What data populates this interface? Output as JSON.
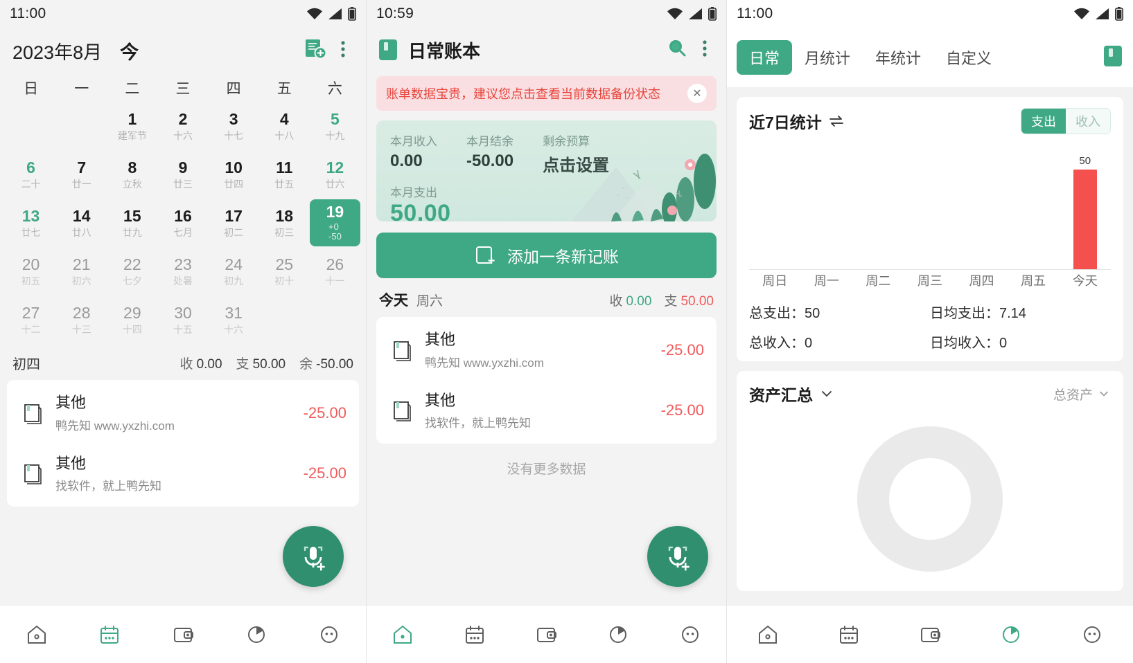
{
  "theme": {
    "green": "#3fa885",
    "green_dark": "#2f8f6e",
    "red": "#f05a5a",
    "bar_red": "#f4514e",
    "alert_bg": "#f9dfe2",
    "alert_text": "#e8453c"
  },
  "panel1": {
    "status": {
      "time": "11:00"
    },
    "header": {
      "month_title": "2023年8月",
      "today_label": "今",
      "add_note_icon": "note-add-icon",
      "more_icon": "more-vertical-icon"
    },
    "weekdays": [
      "日",
      "一",
      "二",
      "三",
      "四",
      "五",
      "六"
    ],
    "days": [
      {
        "num": "",
        "lunar": "",
        "empty": true
      },
      {
        "num": "",
        "lunar": "",
        "empty": true
      },
      {
        "num": "1",
        "lunar": "建军节"
      },
      {
        "num": "2",
        "lunar": "十六"
      },
      {
        "num": "3",
        "lunar": "十七"
      },
      {
        "num": "4",
        "lunar": "十八"
      },
      {
        "num": "5",
        "lunar": "十九",
        "weekend": true
      },
      {
        "num": "6",
        "lunar": "二十",
        "weekend": true
      },
      {
        "num": "7",
        "lunar": "廿一"
      },
      {
        "num": "8",
        "lunar": "立秋"
      },
      {
        "num": "9",
        "lunar": "廿三"
      },
      {
        "num": "10",
        "lunar": "廿四"
      },
      {
        "num": "11",
        "lunar": "廿五"
      },
      {
        "num": "12",
        "lunar": "廿六",
        "weekend": true
      },
      {
        "num": "13",
        "lunar": "廿七",
        "weekend": true
      },
      {
        "num": "14",
        "lunar": "廿八"
      },
      {
        "num": "15",
        "lunar": "廿九"
      },
      {
        "num": "16",
        "lunar": "七月"
      },
      {
        "num": "17",
        "lunar": "初二"
      },
      {
        "num": "18",
        "lunar": "初三"
      },
      {
        "num": "19",
        "lunar": "+0\n-50",
        "selected": true
      },
      {
        "num": "20",
        "lunar": "初五",
        "grey": true
      },
      {
        "num": "21",
        "lunar": "初六",
        "grey": true
      },
      {
        "num": "22",
        "lunar": "七夕",
        "grey": true
      },
      {
        "num": "23",
        "lunar": "处暑",
        "grey": true
      },
      {
        "num": "24",
        "lunar": "初九",
        "grey": true
      },
      {
        "num": "25",
        "lunar": "初十",
        "grey": true
      },
      {
        "num": "26",
        "lunar": "十一",
        "grey": true
      },
      {
        "num": "27",
        "lunar": "十二",
        "grey": true
      },
      {
        "num": "28",
        "lunar": "十三",
        "grey": true
      },
      {
        "num": "29",
        "lunar": "十四",
        "grey": true
      },
      {
        "num": "30",
        "lunar": "十五",
        "grey": true
      },
      {
        "num": "31",
        "lunar": "十六",
        "grey": true
      }
    ],
    "day_summary": {
      "lunar": "初四",
      "income_label": "收",
      "income_value": "0.00",
      "expense_label": "支",
      "expense_value": "50.00",
      "balance_label": "余",
      "balance_value": "-50.00"
    },
    "transactions": [
      {
        "name": "其他",
        "desc": "鸭先知 www.yxzhi.com",
        "amount": "-25.00"
      },
      {
        "name": "其他",
        "desc": "找软件，就上鸭先知",
        "amount": "-25.00"
      }
    ],
    "fab": {
      "icon": "mic-add-icon"
    },
    "bottomnav": [
      {
        "icon": "home-icon",
        "active": false
      },
      {
        "icon": "calendar-icon",
        "active": true
      },
      {
        "icon": "wallet-icon",
        "active": false
      },
      {
        "icon": "pie-chart-icon",
        "active": false
      },
      {
        "icon": "more-circle-icon",
        "active": false
      }
    ]
  },
  "panel2": {
    "status": {
      "time": "10:59"
    },
    "header": {
      "book_icon": "ledger-icon",
      "title": "日常账本",
      "search_icon": "search-icon",
      "more_icon": "more-vertical-icon"
    },
    "alert": {
      "text": "账单数据宝贵，建议您点击查看当前数据备份状态",
      "close_icon": "close-icon"
    },
    "summary": {
      "income_label": "本月收入",
      "income_value": "0.00",
      "balance_label": "本月结余",
      "balance_value": "-50.00",
      "budget_label": "剩余预算",
      "budget_value": "点击设置",
      "expense_label": "本月支出",
      "expense_value": "50.00"
    },
    "add_button": {
      "label": "添加一条新记账",
      "icon": "note-add-icon"
    },
    "daybar": {
      "day": "今天",
      "weekday": "周六",
      "income_label": "收",
      "income_value": "0.00",
      "expense_label": "支",
      "expense_value": "50.00"
    },
    "transactions": [
      {
        "name": "其他",
        "desc": "鸭先知 www.yxzhi.com",
        "amount": "-25.00"
      },
      {
        "name": "其他",
        "desc": "找软件，就上鸭先知",
        "amount": "-25.00"
      }
    ],
    "no_more": "没有更多数据",
    "fab": {
      "icon": "mic-add-icon"
    },
    "bottomnav": [
      {
        "icon": "home-icon",
        "active": true
      },
      {
        "icon": "calendar-icon",
        "active": false
      },
      {
        "icon": "wallet-icon",
        "active": false
      },
      {
        "icon": "pie-chart-icon",
        "active": false
      },
      {
        "icon": "more-circle-icon",
        "active": false
      }
    ]
  },
  "panel3": {
    "status": {
      "time": "11:00"
    },
    "tabs": [
      {
        "label": "日常",
        "active": true
      },
      {
        "label": "月统计",
        "active": false
      },
      {
        "label": "年统计",
        "active": false
      },
      {
        "label": "自定义",
        "active": false
      }
    ],
    "tab_right_icon": "ledger-icon",
    "stats_card": {
      "title": "近7日统计",
      "swap_icon": "swap-icon",
      "segment": [
        {
          "label": "支出",
          "active": true
        },
        {
          "label": "收入",
          "active": false
        }
      ],
      "total_expense_label": "总支出：50",
      "avg_expense_label": "日均支出：7.14",
      "total_income_label": "总收入：0",
      "avg_income_label": "日均收入：0"
    },
    "assets": {
      "title": "资产汇总",
      "chevron_icon": "chevron-down-icon",
      "right_label": "总资产",
      "right_chevron_icon": "chevron-down-icon"
    },
    "bottomnav": [
      {
        "icon": "home-icon",
        "active": false
      },
      {
        "icon": "calendar-icon",
        "active": false
      },
      {
        "icon": "wallet-icon",
        "active": false
      },
      {
        "icon": "pie-chart-icon",
        "active": true
      },
      {
        "icon": "more-circle-icon",
        "active": false
      }
    ]
  },
  "chart_data": {
    "type": "bar",
    "title": "近7日统计",
    "categories": [
      "周日",
      "周一",
      "周二",
      "周三",
      "周四",
      "周五",
      "今天"
    ],
    "values": [
      0,
      0,
      0,
      0,
      0,
      0,
      50
    ],
    "value_labels": [
      "",
      "",
      "",
      "",
      "",
      "",
      "50"
    ],
    "series": [
      {
        "name": "支出",
        "values": [
          0,
          0,
          0,
          0,
          0,
          0,
          50
        ]
      }
    ],
    "xlabel": "",
    "ylabel": "",
    "ylim": [
      0,
      55
    ],
    "grid": false,
    "legend": "none",
    "bar_color": "#f4514e",
    "summary": {
      "total_expense": 50,
      "avg_expense": 7.14,
      "total_income": 0,
      "avg_income": 0
    }
  }
}
